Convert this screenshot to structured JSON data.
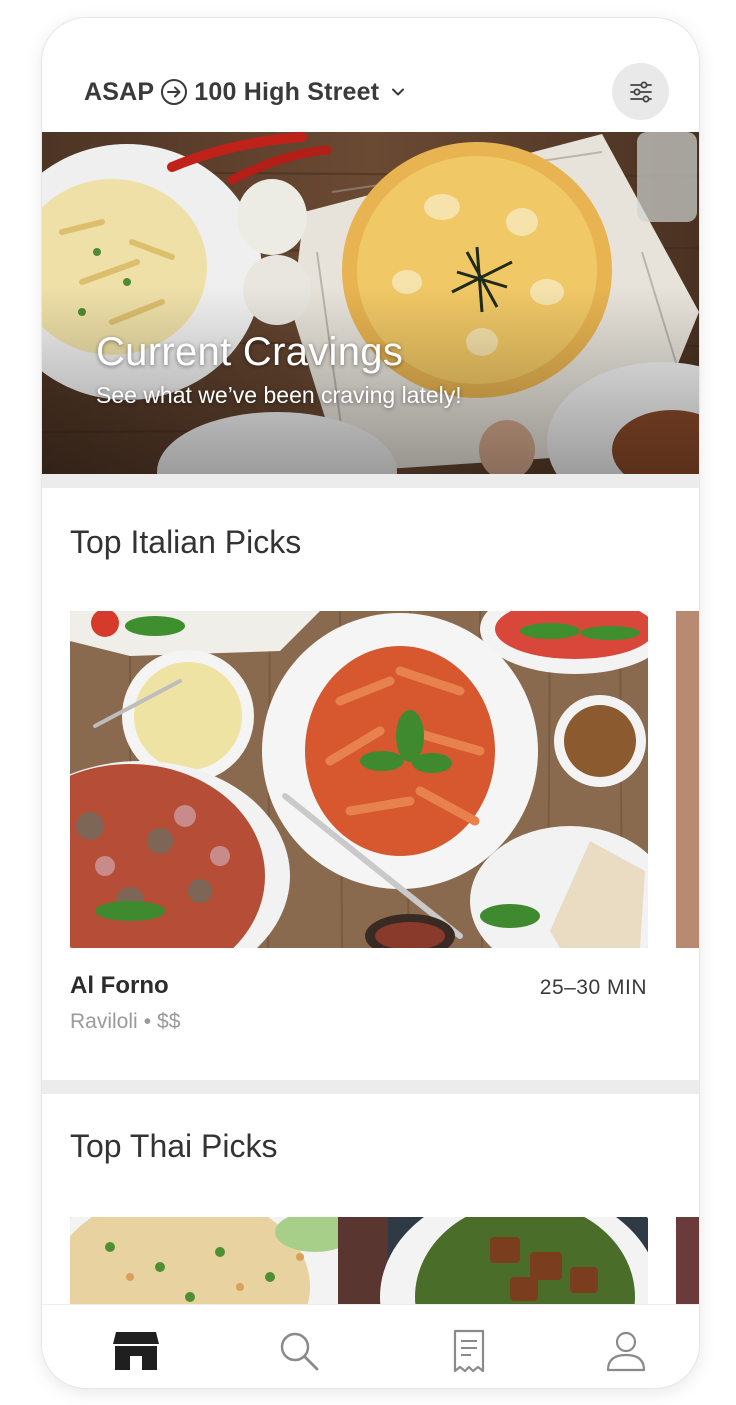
{
  "header": {
    "timing": "ASAP",
    "address": "100 High Street",
    "icons": {
      "arrow": "arrow-circle-right-icon",
      "chevron": "chevron-down-icon",
      "filter": "filter-sliders-icon"
    }
  },
  "hero": {
    "title": "Current Cravings",
    "subtitle": "See what we’ve been craving lately!"
  },
  "sections": [
    {
      "title": "Top Italian Picks",
      "restaurant": {
        "name": "Al Forno",
        "time": "25–30 MIN",
        "cuisine": "Raviloli",
        "separator": "•",
        "price": "$$"
      }
    },
    {
      "title": "Top Thai Picks"
    }
  ],
  "tabbar": {
    "items": [
      {
        "icon": "store-icon",
        "active": true
      },
      {
        "icon": "search-icon",
        "active": false
      },
      {
        "icon": "receipt-icon",
        "active": false
      },
      {
        "icon": "account-icon",
        "active": false
      }
    ]
  },
  "colors": {
    "accent": "#1f1f1f",
    "inactive_icon": "#8a8a8a",
    "background": "#ececec"
  }
}
